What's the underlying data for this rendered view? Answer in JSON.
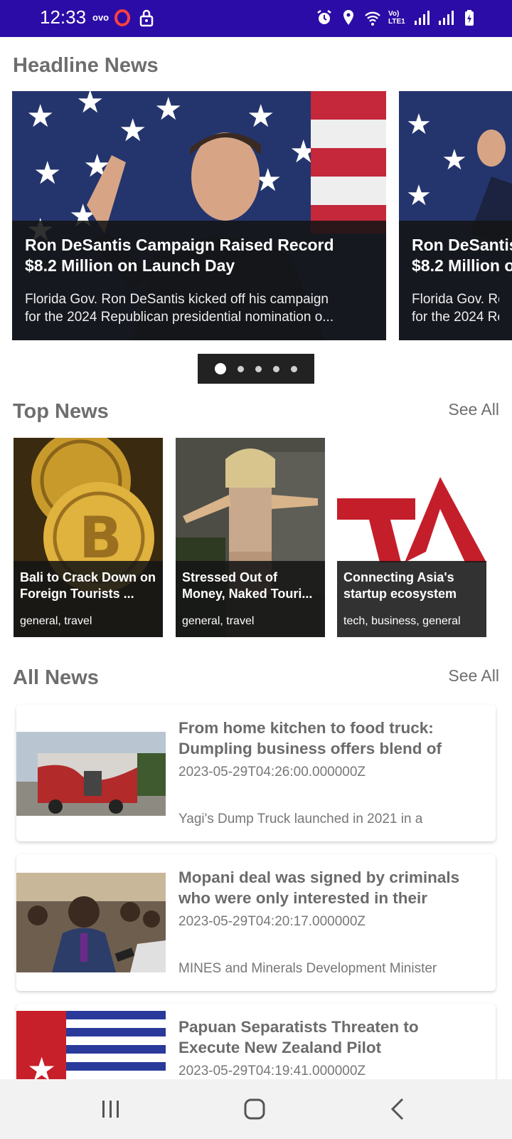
{
  "status_bar": {
    "time": "12:33",
    "carrier": "ovo",
    "icons": [
      "opera-icon",
      "lock-icon",
      "alarm-icon",
      "location-icon",
      "wifi-icon",
      "volte-icon",
      "signal-icon",
      "signal-icon-2",
      "battery-icon"
    ],
    "volte_label": "Vo) LTE1"
  },
  "colors": {
    "status_bar": "#2c0ca6",
    "overlay": "#161616",
    "heading": "#6e6e6e"
  },
  "headline": {
    "title": "Headline News",
    "items": [
      {
        "title_line1": "Ron DeSantis Campaign Raised Record",
        "title_line2": "$8.2 Million on Launch Day",
        "desc_line1": "Florida Gov. Ron DeSantis kicked off his campaign",
        "desc_line2": "for the 2024 Republican presidential nomination o..."
      },
      {
        "title_line1": "Ron DeSantis",
        "title_line2": "$8.2 Million o",
        "desc_line1": "Florida Gov. Ro",
        "desc_line2": "for the 2024 Re"
      }
    ],
    "page_count": 5,
    "active_page": 1
  },
  "top_news": {
    "title": "Top News",
    "see_all": "See All",
    "items": [
      {
        "title": "Bali to Crack Down on Foreign Tourists ...",
        "tags": "general, travel"
      },
      {
        "title": "Stressed Out of Money, Naked Touri...",
        "tags": "general, travel"
      },
      {
        "title": "Connecting Asia's startup ecosystem",
        "tags": "tech, business, general"
      }
    ]
  },
  "all_news": {
    "title": "All News",
    "see_all": "See All",
    "items": [
      {
        "title": "From home kitchen to food truck: Dumpling business offers blend of",
        "date": "2023-05-29T04:26:00.000000Z",
        "desc": "Yagi's Dump Truck launched in 2021 in a"
      },
      {
        "title": "Mopani deal was signed by criminals who were only interested in their",
        "date": "2023-05-29T04:20:17.000000Z",
        "desc": "MINES and Minerals Development Minister"
      },
      {
        "title": "Papuan Separatists Threaten to Execute New Zealand Pilot",
        "date": "2023-05-29T04:19:41.000000Z",
        "desc": ""
      }
    ]
  },
  "nav_bar": {
    "buttons": [
      "recents-icon",
      "home-icon",
      "back-icon"
    ]
  }
}
